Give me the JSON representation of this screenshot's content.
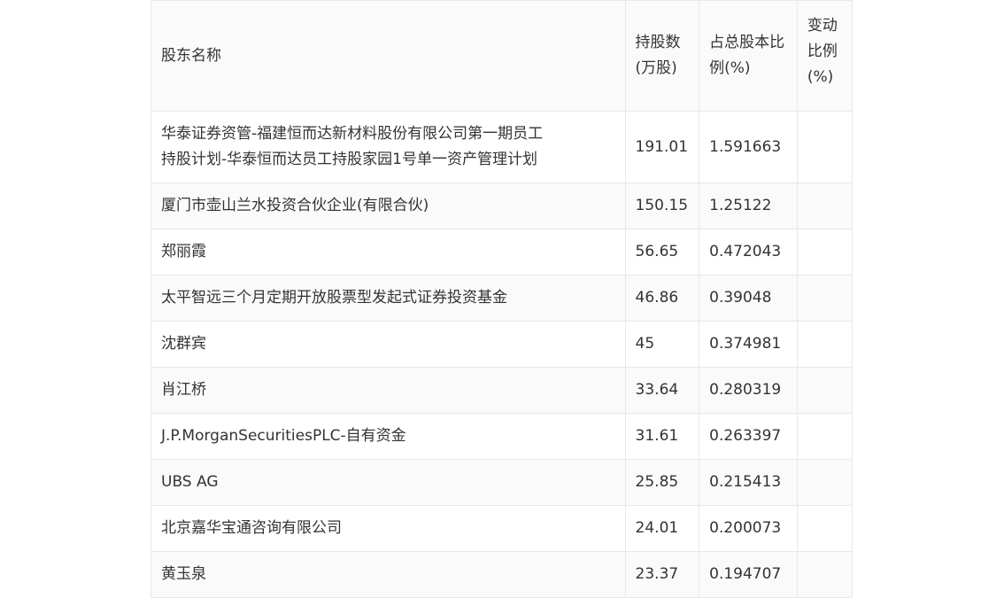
{
  "table": {
    "headers": {
      "name": "股东名称",
      "shares_line1": "持股数",
      "shares_line2": "(万股)",
      "ratio_line1": "占总股本比",
      "ratio_line2": "例(%)",
      "change_line1": "变动",
      "change_line2": "比例",
      "change_line3": "(%)"
    },
    "rows": [
      {
        "name_line1": "华泰证券资管-福建恒而达新材料股份有限公司第一期员工",
        "name_line2": "持股计划-华泰恒而达员工持股家园1号单一资产管理计划",
        "shares": "191.01",
        "ratio": "1.591663",
        "change": ""
      },
      {
        "name": "厦门市壶山兰水投资合伙企业(有限合伙)",
        "shares": "150.15",
        "ratio": "1.25122",
        "change": ""
      },
      {
        "name": "郑丽霞",
        "shares": "56.65",
        "ratio": "0.472043",
        "change": ""
      },
      {
        "name": "太平智远三个月定期开放股票型发起式证券投资基金",
        "shares": "46.86",
        "ratio": "0.39048",
        "change": ""
      },
      {
        "name": "沈群宾",
        "shares": "45",
        "ratio": "0.374981",
        "change": ""
      },
      {
        "name": "肖江桥",
        "shares": "33.64",
        "ratio": "0.280319",
        "change": ""
      },
      {
        "name": "J.P.MorganSecuritiesPLC-自有资金",
        "shares": "31.61",
        "ratio": "0.263397",
        "change": ""
      },
      {
        "name": "UBS AG",
        "shares": "25.85",
        "ratio": "0.215413",
        "change": ""
      },
      {
        "name": "北京嘉华宝通咨询有限公司",
        "shares": "24.01",
        "ratio": "0.200073",
        "change": ""
      },
      {
        "name": "黄玉泉",
        "shares": "23.37",
        "ratio": "0.194707",
        "change": ""
      }
    ]
  }
}
